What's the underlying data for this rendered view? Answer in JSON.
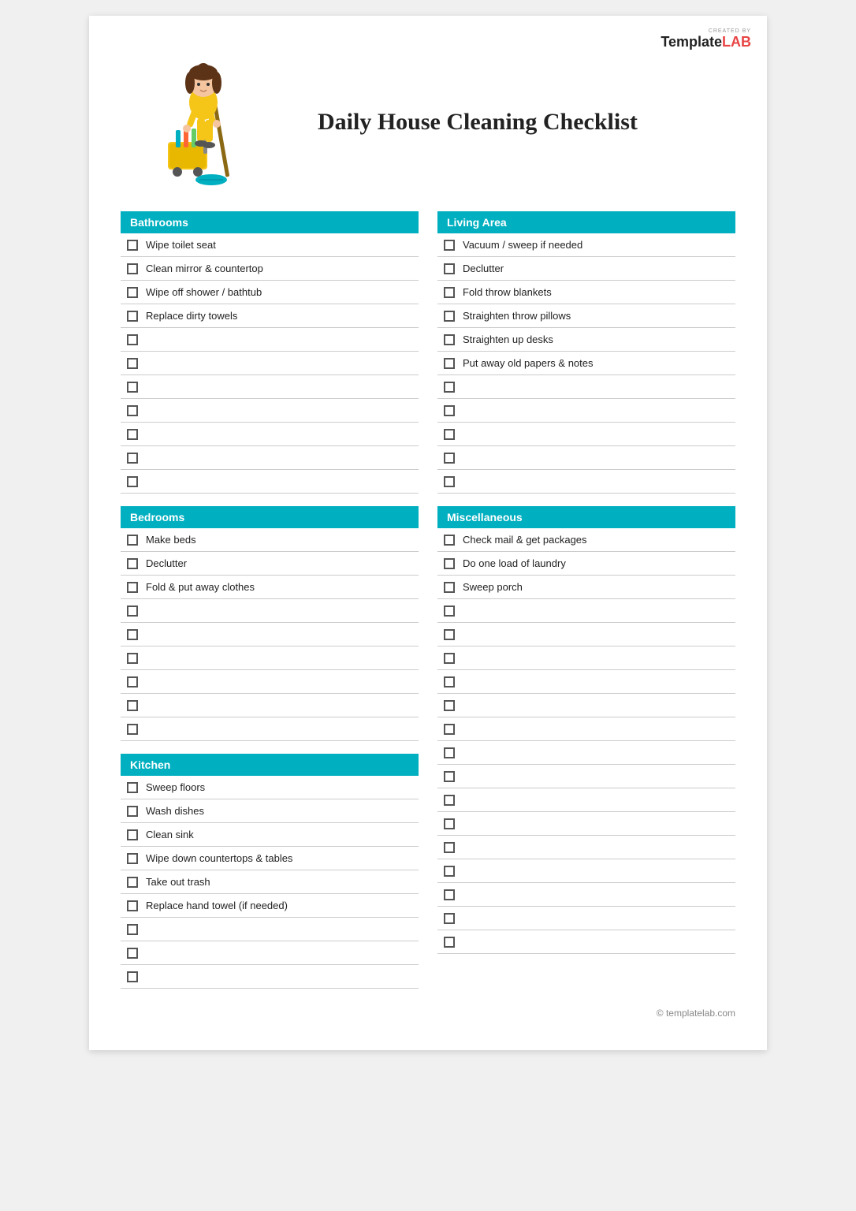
{
  "logo": {
    "created_by": "CREATED BY",
    "template": "Template",
    "lab": "LAB"
  },
  "title": "Daily House Cleaning Checklist",
  "footer": "© templatelab.com",
  "sections": {
    "bathrooms": {
      "label": "Bathrooms",
      "items": [
        "Wipe toilet seat",
        "Clean mirror & countertop",
        "Wipe off shower / bathtub",
        "Replace dirty towels",
        "",
        "",
        "",
        "",
        "",
        "",
        ""
      ]
    },
    "bedrooms": {
      "label": "Bedrooms",
      "items": [
        "Make beds",
        "Declutter",
        "Fold & put away clothes",
        "",
        "",
        "",
        "",
        "",
        ""
      ]
    },
    "kitchen": {
      "label": "Kitchen",
      "items": [
        "Sweep floors",
        "Wash dishes",
        "Clean sink",
        "Wipe down countertops & tables",
        "Take out trash",
        "Replace hand towel (if needed)",
        "",
        "",
        ""
      ]
    },
    "living_area": {
      "label": "Living Area",
      "items": [
        "Vacuum / sweep if needed",
        "Declutter",
        "Fold throw blankets",
        "Straighten throw pillows",
        "Straighten up desks",
        "Put away old papers & notes",
        "",
        "",
        "",
        "",
        ""
      ]
    },
    "miscellaneous": {
      "label": "Miscellaneous",
      "items": [
        "Check mail & get packages",
        "Do one load of laundry",
        "Sweep porch",
        "",
        "",
        "",
        "",
        "",
        "",
        "",
        "",
        "",
        "",
        "",
        ""
      ]
    }
  }
}
